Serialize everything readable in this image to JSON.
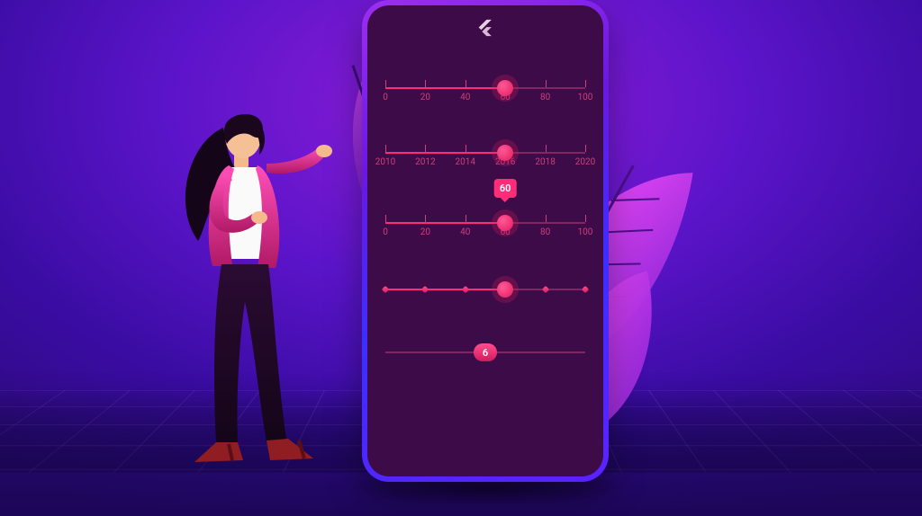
{
  "accent": "#ff2d78",
  "phone": {
    "sliders": [
      {
        "id": "scale-0-100",
        "min": 0,
        "max": 100,
        "step_ticks": [
          0,
          20,
          40,
          60,
          80,
          100
        ],
        "tick_labels": [
          "0",
          "20",
          "40",
          "60",
          "80",
          "100"
        ],
        "value": 60
      },
      {
        "id": "years",
        "min": 2010,
        "max": 2020,
        "step_ticks": [
          2010,
          2012,
          2014,
          2016,
          2018,
          2020
        ],
        "tick_labels": [
          "2010",
          "2012",
          "2014",
          "2016",
          "2018",
          "2020"
        ],
        "value": 2016
      },
      {
        "id": "tooltip-scale",
        "min": 0,
        "max": 100,
        "step_ticks": [
          0,
          20,
          40,
          60,
          80,
          100
        ],
        "tick_labels": [
          "0",
          "20",
          "40",
          "60",
          "80",
          "100"
        ],
        "value": 60,
        "tooltip": "60"
      },
      {
        "id": "diamond-ticks",
        "min": 0,
        "max": 5,
        "diamond_positions": [
          0,
          1,
          2,
          3,
          4,
          5
        ],
        "value": 3
      },
      {
        "id": "numeric-pill",
        "min": 0,
        "max": 12,
        "value": 6,
        "pill_label": "6"
      }
    ]
  }
}
